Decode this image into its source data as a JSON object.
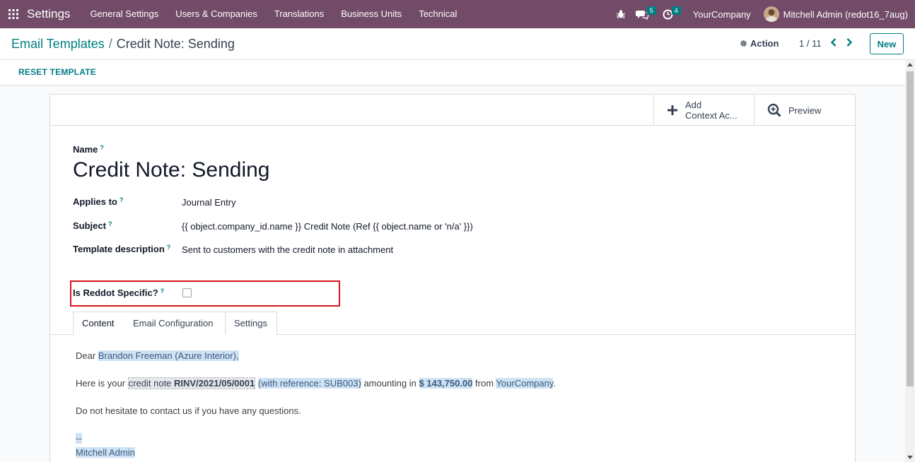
{
  "navbar": {
    "brand": "Settings",
    "menu": [
      "General Settings",
      "Users & Companies",
      "Translations",
      "Business Units",
      "Technical"
    ],
    "messages_count": "5",
    "activities_count": "4",
    "company": "YourCompany",
    "user": "Mitchell Admin (redot16_7aug)"
  },
  "control": {
    "breadcrumb_parent": "Email Templates",
    "breadcrumb_separator": "/",
    "breadcrumb_current": "Credit Note: Sending",
    "action_label": "Action",
    "pager": "1 / 11",
    "new_label": "New"
  },
  "statusbar": {
    "reset_label": "RESET TEMPLATE"
  },
  "button_box": {
    "add_context_line1": "Add",
    "add_context_line2": "Context Ac...",
    "preview_label": "Preview"
  },
  "form": {
    "name_label": "Name",
    "name_value": "Credit Note: Sending",
    "applies_to_label": "Applies to",
    "applies_to_value": "Journal Entry",
    "subject_label": "Subject",
    "subject_value": "{{ object.company_id.name }} Credit Note (Ref {{ object.name or 'n/a' }})",
    "description_label": "Template description",
    "description_value": "Sent to customers with the credit note in attachment",
    "reddot_label": "Is Reddot Specific?",
    "help_marker": "?",
    "reddot_checked": false
  },
  "tabs": [
    "Content",
    "Email Configuration",
    "Settings"
  ],
  "body": {
    "dear": "Dear",
    "partner": "Brandon Freeman",
    "partner_parent": "(Azure Interior),",
    "here_is": "Here is your",
    "credit_note_word": "credit note",
    "invoice_ref": "RINV/2021/05/0001",
    "reference_text": "(with reference: SUB003)",
    "amounting_in": "amounting in",
    "amount": "$ 143,750.00",
    "from_word": "from",
    "company": "YourCompany",
    "period": ".",
    "contact": "Do not hesitate to contact us if you have any questions.",
    "sig_dash": "--",
    "signature": "Mitchell Admin"
  },
  "colors": {
    "navbar": "#714B67",
    "accent": "#017E84",
    "highlight_border": "#d7141a"
  }
}
